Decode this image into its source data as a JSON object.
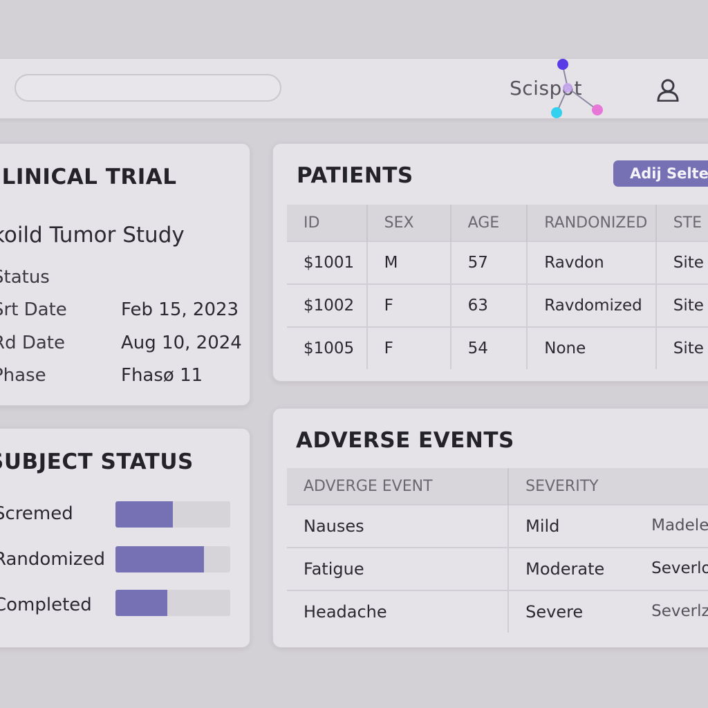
{
  "header": {
    "search": {
      "placeholder": "",
      "value": ""
    },
    "logo_text": "Scispot",
    "user_icon": "user-icon"
  },
  "trial": {
    "title": "ELINICAL TRIAL",
    "study_name": "koild Tumor Study",
    "rows": [
      {
        "label": "Status",
        "value": ""
      },
      {
        "label": "Srt Date",
        "value": "Feb 15, 2023"
      },
      {
        "label": "Rd Date",
        "value": "Aug 10, 2024"
      },
      {
        "label": "Phase",
        "value": "Fhasø 11"
      }
    ]
  },
  "subject_status": {
    "title": "SUBJECT STATUS",
    "accent_color": "#7670b4",
    "items": [
      {
        "label": "Scremed",
        "fraction": 0.5
      },
      {
        "label": "Randomized",
        "fraction": 0.77
      },
      {
        "label": "Completed",
        "fraction": 0.45
      }
    ]
  },
  "patients": {
    "title": "PATIENTS",
    "button_label": "Adij Seltew",
    "columns": [
      "ID",
      "SEX",
      "AGE",
      "RANDONIZED",
      "STE"
    ],
    "rows": [
      [
        "$1001",
        "M",
        "57",
        "Ravdon",
        "Site"
      ],
      [
        "$1002",
        "F",
        "63",
        "Ravdomized",
        "Site"
      ],
      [
        "$1005",
        "F",
        "54",
        "None",
        "Site"
      ]
    ]
  },
  "adverse_events": {
    "title": "ADVERSE EVENTS",
    "columns": [
      "ADVERGE EVENT",
      "SEVERITY"
    ],
    "rows": [
      [
        "Nauses",
        "Mild",
        "Madele"
      ],
      [
        "Fatigue",
        "Moderate",
        "Severlo"
      ],
      [
        "Headache",
        "Severe",
        "Severlz"
      ]
    ]
  }
}
